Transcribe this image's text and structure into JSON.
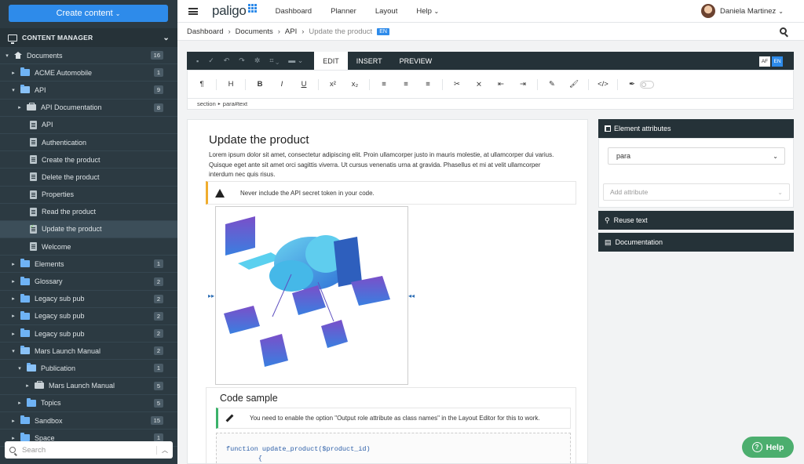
{
  "sidebar": {
    "create_label": "Create content",
    "manager_label": "CONTENT MANAGER",
    "search_placeholder": "Search",
    "tree": [
      {
        "label": "Documents",
        "count": "16",
        "level": 0,
        "icon": "house-icon",
        "twisty": "▾"
      },
      {
        "label": "ACME Automobile",
        "count": "1",
        "level": 1,
        "icon": "folder-icon",
        "twisty": "▸"
      },
      {
        "label": "API",
        "count": "9",
        "level": 1,
        "icon": "folder-open-icon",
        "twisty": "▾"
      },
      {
        "label": "API Documentation",
        "count": "8",
        "level": 2,
        "icon": "publication-icon",
        "twisty": "▸"
      },
      {
        "label": "API",
        "count": "",
        "level": 3,
        "icon": "topic-icon",
        "twisty": ""
      },
      {
        "label": "Authentication",
        "count": "",
        "level": 3,
        "icon": "topic-icon",
        "twisty": ""
      },
      {
        "label": "Create the product",
        "count": "",
        "level": 3,
        "icon": "topic-icon",
        "twisty": ""
      },
      {
        "label": "Delete the product",
        "count": "",
        "level": 3,
        "icon": "topic-icon",
        "twisty": ""
      },
      {
        "label": "Properties",
        "count": "",
        "level": 3,
        "icon": "topic-icon",
        "twisty": ""
      },
      {
        "label": "Read the product",
        "count": "",
        "level": 3,
        "icon": "topic-icon",
        "twisty": ""
      },
      {
        "label": "Update the product",
        "count": "",
        "level": 3,
        "icon": "topic-icon",
        "twisty": "",
        "selected": true
      },
      {
        "label": "Welcome",
        "count": "",
        "level": 3,
        "icon": "topic-icon",
        "twisty": ""
      },
      {
        "label": "Elements",
        "count": "1",
        "level": 1,
        "icon": "folder-icon",
        "twisty": "▸"
      },
      {
        "label": "Glossary",
        "count": "2",
        "level": 1,
        "icon": "folder-icon",
        "twisty": "▸"
      },
      {
        "label": "Legacy sub pub",
        "count": "2",
        "level": 1,
        "icon": "folder-icon",
        "twisty": "▸"
      },
      {
        "label": "Legacy sub pub",
        "count": "2",
        "level": 1,
        "icon": "folder-icon",
        "twisty": "▸"
      },
      {
        "label": "Legacy sub pub",
        "count": "2",
        "level": 1,
        "icon": "folder-icon",
        "twisty": "▸"
      },
      {
        "label": "Mars Launch Manual",
        "count": "2",
        "level": 1,
        "icon": "folder-open-icon",
        "twisty": "▾"
      },
      {
        "label": "Publication",
        "count": "1",
        "level": 2,
        "icon": "folder-open-icon",
        "twisty": "▾"
      },
      {
        "label": "Mars Launch Manual",
        "count": "5",
        "level": 3,
        "icon": "publication-icon",
        "twisty": "▸"
      },
      {
        "label": "Topics",
        "count": "5",
        "level": 2,
        "icon": "folder-icon",
        "twisty": "▸"
      },
      {
        "label": "Sandbox",
        "count": "15",
        "level": 1,
        "icon": "folder-icon",
        "twisty": "▸"
      },
      {
        "label": "Space",
        "count": "1",
        "level": 1,
        "icon": "folder-icon",
        "twisty": "▸"
      }
    ]
  },
  "topbar": {
    "logo": "paligo",
    "nav": [
      "Dashboard",
      "Planner",
      "Layout",
      "Help"
    ],
    "user": "Daniela Martinez"
  },
  "breadcrumb": {
    "items": [
      "Dashboard",
      "Documents",
      "API"
    ],
    "current": "Update the product",
    "lang": "EN"
  },
  "editor": {
    "tabs": [
      "EDIT",
      "INSERT",
      "PREVIEW"
    ],
    "lang_af": "AF",
    "lang_en": "EN",
    "path_section": "section",
    "path_para": "para#text",
    "format_buttons": [
      "¶",
      "H",
      "B",
      "I",
      "U",
      "x²",
      "x₂",
      "≡",
      "≡",
      "≡",
      "✂",
      "⨯",
      "⇤",
      "⇥",
      "✎",
      "🖌",
      "</>",
      "✒"
    ]
  },
  "document": {
    "title": "Update the product",
    "paragraph": "Lorem ipsum dolor sit amet, consectetur adipiscing elit. Proin ullamcorper justo in mauris molestie, at ullamcorper dui varius. Quisque eget ante sit amet orci sagittis viverra. Ut cursus venenatis urna at gravida. Phasellus et mi at velit ullamcorper interdum nec quis risus.",
    "warning": "Never include the API secret token in your code.",
    "code_title": "Code sample",
    "code_note": "You need to enable the option \"Output role attribute as class names\" in the Layout Editor for this to work.",
    "code": "function update_product($product_id)\n        {"
  },
  "right_panel": {
    "attributes_title": "Element attributes",
    "element_value": "para",
    "add_attribute_placeholder": "Add attribute",
    "reuse_label": "Reuse text",
    "docs_label": "Documentation"
  },
  "help_label": "Help",
  "colors": {
    "sidebar": "#2c3a42",
    "accent": "#2e8bea",
    "help": "#4cae6e",
    "warning": "#f0ad2e",
    "note": "#3bb26a"
  }
}
